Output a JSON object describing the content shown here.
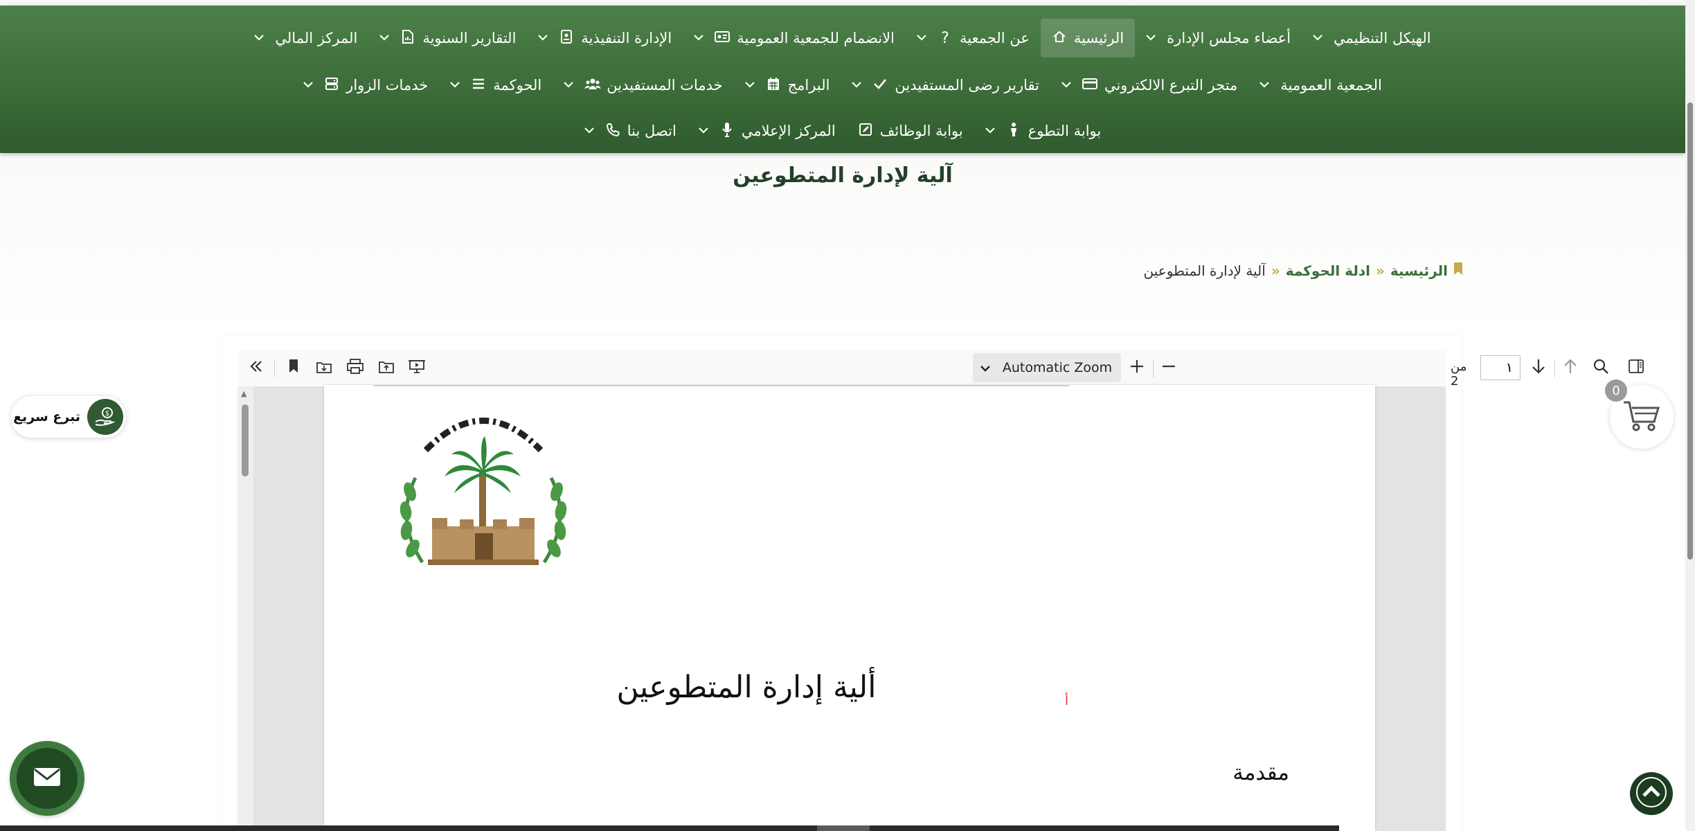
{
  "nav": {
    "row1": [
      {
        "label": "الهيكل التنظيمي",
        "icon": "",
        "dropdown": true
      },
      {
        "label": "أعضاء مجلس الإدارة",
        "icon": "",
        "dropdown": true
      },
      {
        "label": "الرئيسية",
        "icon": "home-icon",
        "dropdown": false,
        "active": true
      },
      {
        "label": "عن الجمعية",
        "icon": "question-icon",
        "dropdown": true
      },
      {
        "label": "الانضمام للجمعية العمومية",
        "icon": "id-card-icon",
        "dropdown": true
      },
      {
        "label": "الإدارة التنفيذية",
        "icon": "address-book-icon",
        "dropdown": true
      },
      {
        "label": "التقارير السنوية",
        "icon": "file-chart-icon",
        "dropdown": true
      },
      {
        "label": "المركز المالي",
        "icon": "",
        "dropdown": true
      }
    ],
    "row2": [
      {
        "label": "الجمعية العمومية",
        "icon": "",
        "dropdown": true
      },
      {
        "label": "متجر التبرع الالكتروني",
        "icon": "credit-card-icon",
        "dropdown": true
      },
      {
        "label": "تقارير رضى المستفيدين",
        "icon": "check-icon",
        "dropdown": true
      },
      {
        "label": "البرامج",
        "icon": "calendar-icon",
        "dropdown": true
      },
      {
        "label": "خدمات المستفيدين",
        "icon": "users-icon",
        "dropdown": true
      },
      {
        "label": "الحوكمة",
        "icon": "list-icon",
        "dropdown": true
      },
      {
        "label": "خدمات الزوار",
        "icon": "server-icon",
        "dropdown": true
      }
    ],
    "row3": [
      {
        "label": "بوابة التطوع",
        "icon": "child-icon",
        "dropdown": true
      },
      {
        "label": "بوابة الوظائف",
        "icon": "edit-icon",
        "dropdown": false
      },
      {
        "label": "المركز الإعلامي",
        "icon": "microphone-icon",
        "dropdown": true
      },
      {
        "label": "اتصل بنا",
        "icon": "phone-icon",
        "dropdown": true
      }
    ]
  },
  "page": {
    "title": "آلية لإدارة المتطوعين",
    "breadcrumb": {
      "home": "الرئيسية",
      "sep1": "»",
      "parent": "ادلة الحوكمة",
      "sep2": "»",
      "current": "آلية لإدارة المتطوعين"
    }
  },
  "pdf_viewer": {
    "zoom_label": "Automatic Zoom",
    "page_value": "١",
    "page_of": "من 2",
    "document": {
      "title": "ألية إدارة المتطوعين",
      "section": "مقدمة",
      "mark": "أ"
    }
  },
  "widgets": {
    "quick_donate_label": "تبرع سريع",
    "cart_count": "0"
  },
  "colors": {
    "nav_green": "#3d6d3a",
    "accent_gold": "#c9a94d",
    "dark_green": "#1c3b1f"
  }
}
